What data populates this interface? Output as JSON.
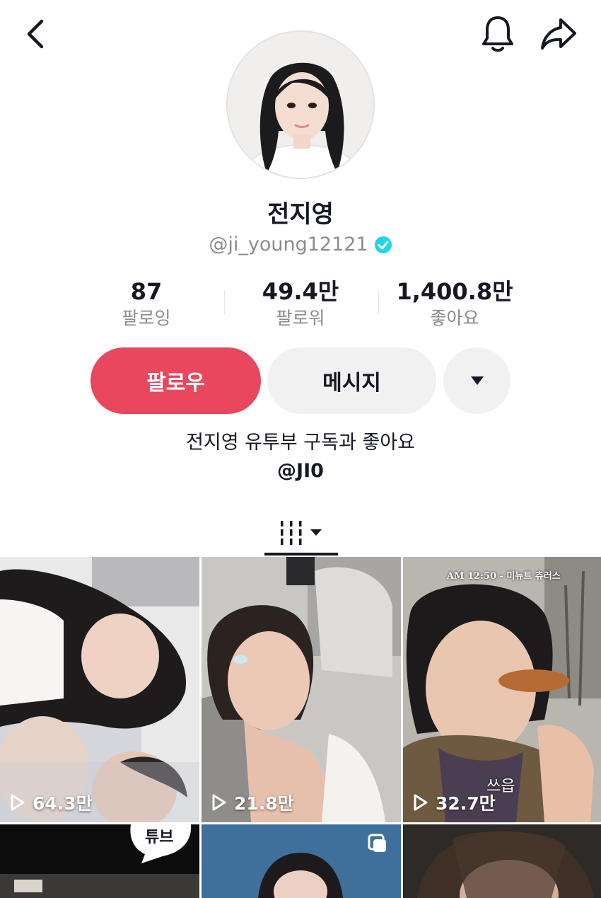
{
  "profile": {
    "display_name": "전지영",
    "handle": "@ji_young12121",
    "verified": true
  },
  "stats": [
    {
      "value": "87",
      "label": "팔로잉"
    },
    {
      "value": "49.4만",
      "label": "팔로워"
    },
    {
      "value": "1,400.8만",
      "label": "좋아요"
    }
  ],
  "actions": {
    "follow_label": "팔로우",
    "message_label": "메시지"
  },
  "bio": {
    "line1": "전지영 유투부 구독과 좋아요",
    "link": "@JI0"
  },
  "videos": [
    {
      "views": "64.3만"
    },
    {
      "views": "21.8만"
    },
    {
      "views": "32.7만",
      "overlay_time": "AM 12:50 - 미뉴트 츄러스",
      "caption": "쓰읍"
    },
    {
      "overlay_text": "튜브"
    },
    {
      "pinned_icon": "multi-photo-icon"
    },
    {}
  ],
  "colors": {
    "follow": "#e8475d",
    "secondary_button": "#f1f1f2",
    "verified": "#20d5ec",
    "muted_text": "#8a8b91"
  }
}
